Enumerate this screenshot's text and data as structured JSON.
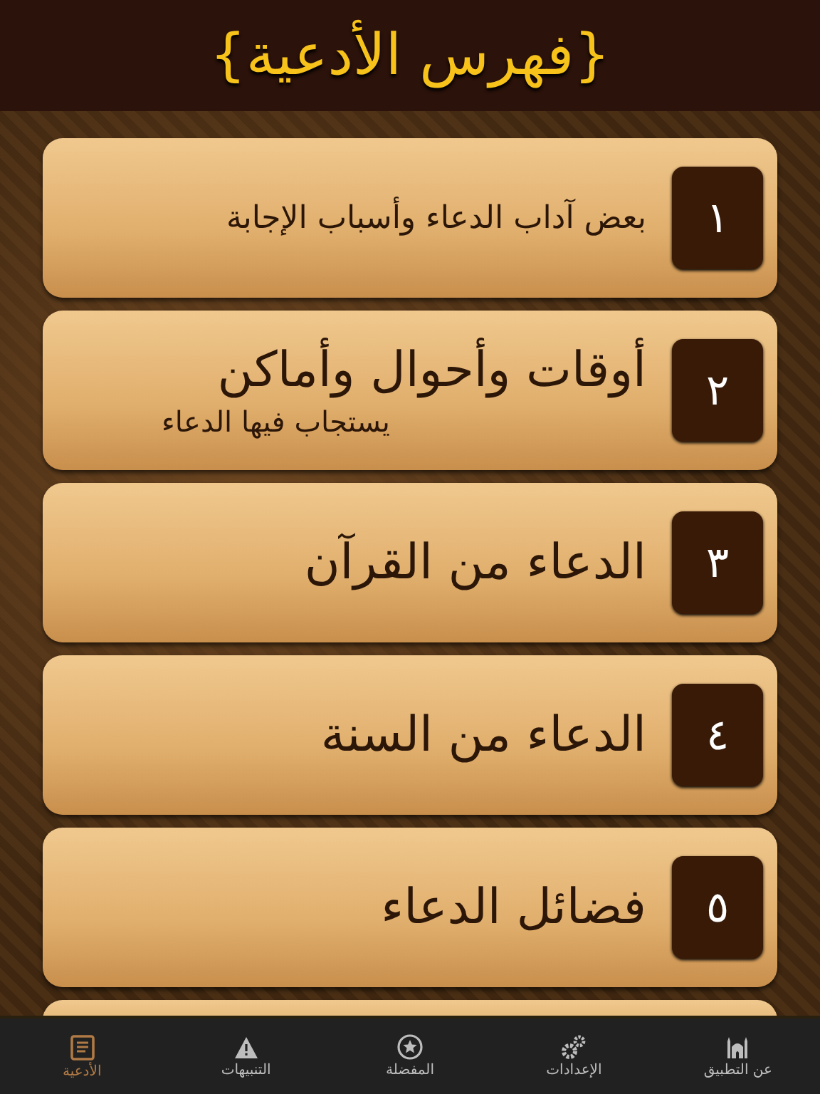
{
  "header": {
    "title": "{فهرس الأدعية}"
  },
  "items": [
    {
      "number": "١",
      "title": "بعض آداب الدعاء وأسباب الإجابة",
      "kind": "compact"
    },
    {
      "number": "٢",
      "title": "أوقات وأحوال وأماكن",
      "subtitle": "يستجاب فيها الدعاء",
      "kind": "plain"
    },
    {
      "number": "٣",
      "title": "الدعاء من القرآن",
      "kind": "plain"
    },
    {
      "number": "٤",
      "title": "الدعاء من السنة",
      "kind": "plain"
    },
    {
      "number": "٥",
      "title": "فضائل الدعاء",
      "kind": "plain"
    }
  ],
  "tab_bar": [
    {
      "label": "عن التطبيق",
      "kind": "mosque",
      "selected": false
    },
    {
      "label": "الإعدادات",
      "kind": "gears",
      "selected": false
    },
    {
      "label": "المفضلة",
      "kind": "star",
      "selected": false
    },
    {
      "label": "التنبيهات",
      "kind": "warning",
      "selected": false
    },
    {
      "label": "الأدعية",
      "kind": "book",
      "selected": true
    }
  ]
}
